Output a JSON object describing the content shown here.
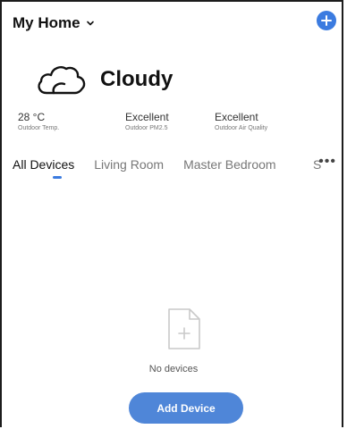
{
  "header": {
    "home_title": "My Home",
    "chevron_icon": "chevron-down-icon",
    "add_icon": "plus-circle-icon"
  },
  "weather": {
    "icon": "cloud-icon",
    "condition": "Cloudy"
  },
  "stats": [
    {
      "value": "28 °C",
      "label": "Outdoor Temp."
    },
    {
      "value": "Excellent",
      "label": "Outdoor PM2.5"
    },
    {
      "value": "Excellent",
      "label": "Outdoor Air Quality"
    }
  ],
  "tabs": [
    "All Devices",
    "Living Room",
    "Master Bedroom"
  ],
  "tab_partial": "S",
  "more_icon": "more-dots-icon",
  "empty": {
    "icon": "add-file-icon",
    "text": "No devices"
  },
  "add_device_button": "Add Device",
  "colors": {
    "accent": "#3b7be0",
    "button": "#4f86d8"
  }
}
